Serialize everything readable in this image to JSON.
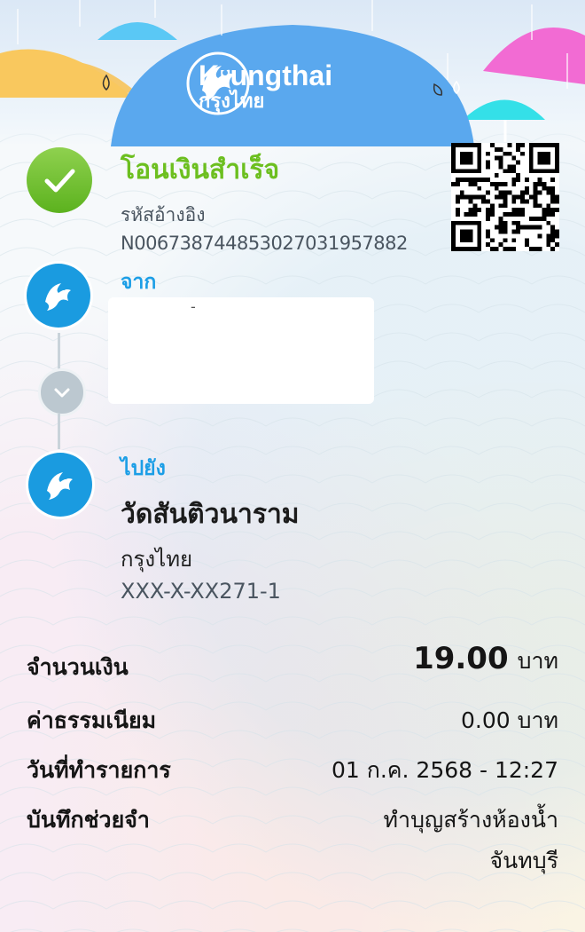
{
  "brand": {
    "name_en": "Krungthai",
    "name_th": "กรุงไทย"
  },
  "status": {
    "title": "โอนเงินสำเร็จ",
    "icon": "check-icon",
    "color": "#6cbf1f"
  },
  "reference": {
    "label": "รหัสอ้างอิง",
    "number": "N00673874485302703195788​2"
  },
  "sender": {
    "label": "จาก",
    "dash": "-"
  },
  "recipient": {
    "label": "ไปยัง",
    "name": "วัดสันติวนาราม",
    "bank": "กรุงไทย",
    "account": "XXX-X-XX271-1"
  },
  "details": {
    "amount": {
      "label": "จำนวนเงิน",
      "value": "19.00",
      "unit": "บาท"
    },
    "fee": {
      "label": "ค่าธรรมเนียม",
      "value": "0.00 บาท"
    },
    "date": {
      "label": "วันที่ทำรายการ",
      "value": "01 ก.ค. 2568 - 12:27"
    },
    "memo": {
      "label": "บันทึกช่วยจำ",
      "line1": "ทำบุญสร้างห้องน้ำ",
      "line2": "จันทบุรี"
    }
  },
  "colors": {
    "accent": "#1c9ee6",
    "success": "#6cbf1f",
    "header_blue": "#5aa8ee"
  }
}
